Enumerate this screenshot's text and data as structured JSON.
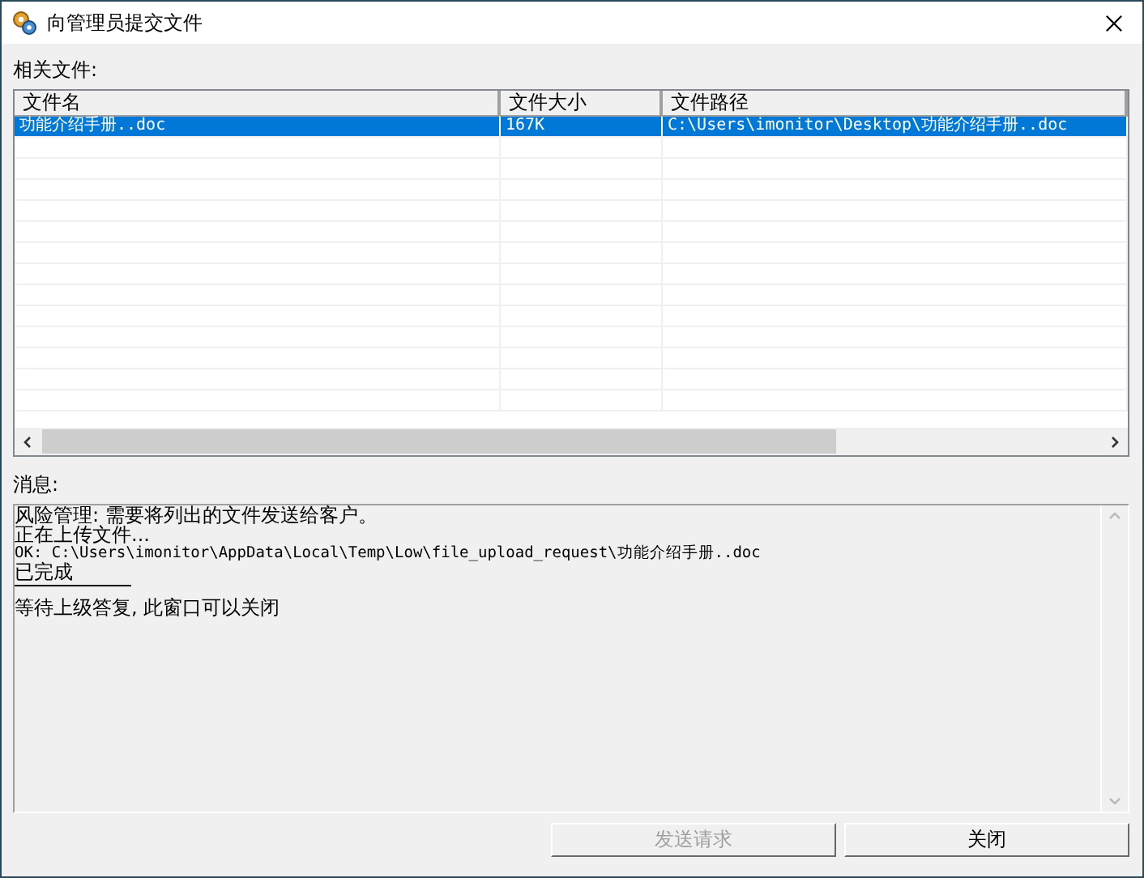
{
  "window": {
    "title": "向管理员提交文件"
  },
  "files_label": "相关文件:",
  "table": {
    "columns": [
      "文件名",
      "文件大小",
      "文件路径"
    ],
    "rows": [
      {
        "cells": [
          "功能介绍手册..doc",
          "167K",
          "C:\\Users\\imonitor\\Desktop\\功能介绍手册..doc"
        ],
        "selected": true
      }
    ]
  },
  "message_label": "消息:",
  "messages": [
    {
      "kind": "text",
      "text": "风险管理: 需要将列出的文件发送给客户。"
    },
    {
      "kind": "text",
      "text": "正在上传文件..."
    },
    {
      "kind": "mono",
      "text": "OK: C:\\Users\\imonitor\\AppData\\Local\\Temp\\Low\\file_upload_request\\功能介绍手册..doc"
    },
    {
      "kind": "text",
      "text": "已完成"
    },
    {
      "kind": "rule"
    },
    {
      "kind": "text",
      "text": "等待上级答复, 此窗口可以关闭"
    }
  ],
  "buttons": [
    {
      "label": "发送请求",
      "disabled": true
    },
    {
      "label": "关闭",
      "disabled": false
    }
  ]
}
